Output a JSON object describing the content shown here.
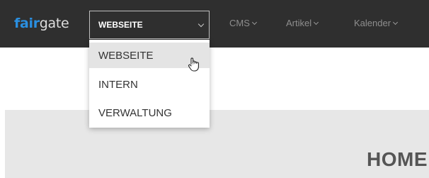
{
  "brand": {
    "part1": "fair",
    "part2": "gate"
  },
  "section_select": {
    "value": "WEBSEITE"
  },
  "nav": [
    "CMS",
    "Artikel",
    "Kalender"
  ],
  "dropdown": {
    "options": [
      {
        "label": "WEBSEITE",
        "hovered": true
      },
      {
        "label": "INTERN",
        "hovered": false
      },
      {
        "label": "VERWALTUNG",
        "hovered": false
      }
    ]
  },
  "page": {
    "heading": "HOME"
  },
  "colors": {
    "topbar": "#2f2f2f",
    "brand_accent": "#2a8fe0",
    "band": "#e7e7e7",
    "hover": "#e4e4e4"
  },
  "icons": {
    "select_arrow": "chevron-down-icon",
    "cursor": "hand-pointer-cursor-icon"
  }
}
